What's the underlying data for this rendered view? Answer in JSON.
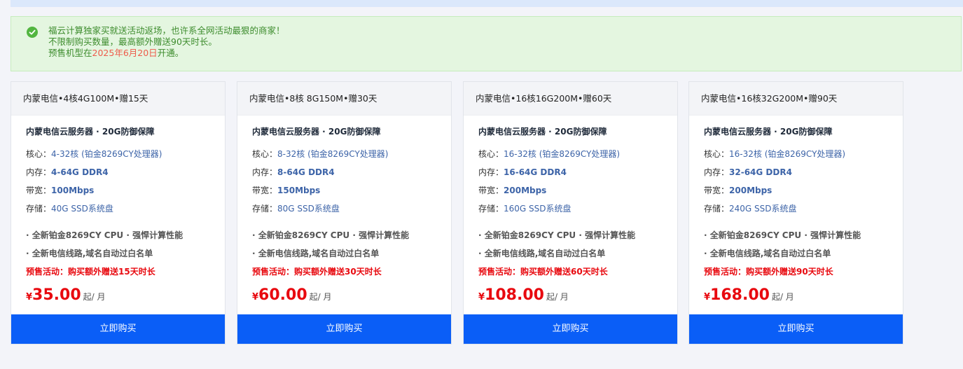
{
  "notice": {
    "line1": "福云计算独家买就送活动返场，也许系全网活动最狠的商家！",
    "line2": "不限制购买数量，最高额外赠送90天时长。",
    "line3_prefix": "预售机型在",
    "line3_date": "2025年6月20日",
    "line3_suffix": "开通。"
  },
  "colors": {
    "accent": "#0a5ef7",
    "notice_green": "#3d8c2d",
    "notice_bg": "#e4f6e0",
    "price_red": "#e8090f",
    "spec_blue": "#3d64a8"
  },
  "labels": {
    "cores": "核心：",
    "memory": "内存：",
    "bandwidth": "带宽：",
    "storage": "存储：",
    "currency": "¥",
    "price_unit": "起/ 月",
    "buy": "立即购买"
  },
  "cards": [
    {
      "title": "内蒙电信•4核4G100M•赠15天",
      "subtitle": "内蒙电信云服务器 · 20G防御保障",
      "cores": "4-32核 (铂金8269CY处理器)",
      "memory": "4-64G DDR4",
      "bandwidth": "100Mbps",
      "storage": "40G SSD系统盘",
      "feature1": "· 全新铂金8269CY CPU · 强悍计算性能",
      "feature2": "· 全新电信线路,域名自动过白名单",
      "promo": "预售活动：购买额外赠送15天时长",
      "price": "35.00"
    },
    {
      "title": "内蒙电信•8核 8G150M•赠30天",
      "subtitle": "内蒙电信云服务器 · 20G防御保障",
      "cores": "8-32核 (铂金8269CY处理器)",
      "memory": "8-64G DDR4",
      "bandwidth": "150Mbps",
      "storage": "80G SSD系统盘",
      "feature1": "· 全新铂金8269CY CPU · 强悍计算性能",
      "feature2": "· 全新电信线路,域名自动过白名单",
      "promo": "预售活动：购买额外赠送30天时长",
      "price": "60.00"
    },
    {
      "title": "内蒙电信•16核16G200M•赠60天",
      "subtitle": "内蒙电信云服务器 · 20G防御保障",
      "cores": "16-32核 (铂金8269CY处理器)",
      "memory": "16-64G DDR4",
      "bandwidth": "200Mbps",
      "storage": "160G SSD系统盘",
      "feature1": "· 全新铂金8269CY CPU · 强悍计算性能",
      "feature2": "· 全新电信线路,域名自动过白名单",
      "promo": "预售活动：购买额外赠送60天时长",
      "price": "108.00"
    },
    {
      "title": "内蒙电信•16核32G200M•赠90天",
      "subtitle": "内蒙电信云服务器 · 20G防御保障",
      "cores": "16-32核 (铂金8269CY处理器)",
      "memory": "32-64G DDR4",
      "bandwidth": "200Mbps",
      "storage": "240G SSD系统盘",
      "feature1": "· 全新铂金8269CY CPU · 强悍计算性能",
      "feature2": "· 全新电信线路,域名自动过白名单",
      "promo": "预售活动：购买额外赠送90天时长",
      "price": "168.00"
    }
  ]
}
